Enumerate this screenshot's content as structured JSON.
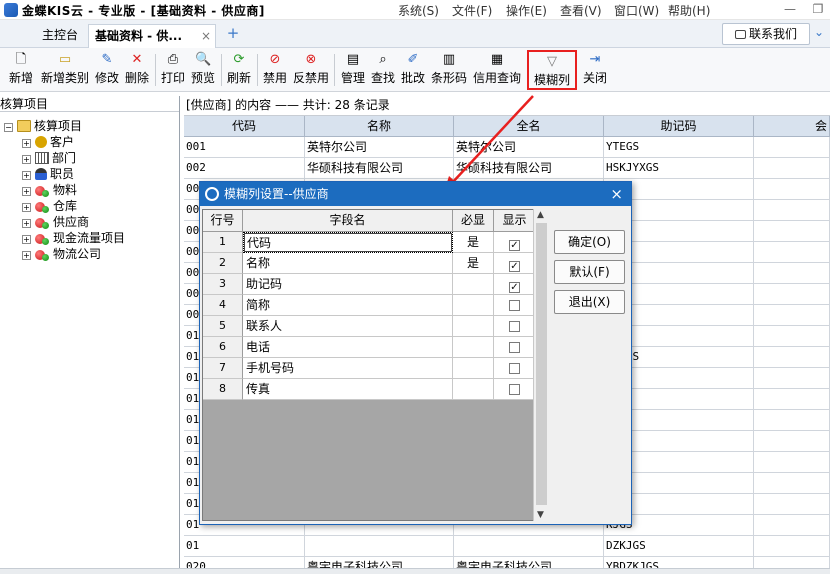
{
  "title_bar": {
    "app_title": "金蝶KIS云 - 专业版 - [基础资料 - 供应商]",
    "menus": [
      "系统(S)",
      "文件(F)",
      "操作(E)",
      "查看(V)",
      "窗口(W)",
      "帮助(H)"
    ]
  },
  "tabs": {
    "main_label": "主控台",
    "supplier_label": "基础资料 - 供...",
    "close_glyph": "×",
    "add_glyph": "+"
  },
  "contact_label": "联系我们",
  "toolbar": {
    "new": "新增",
    "new_category": "新增类别",
    "modify": "修改",
    "delete": "删除",
    "print": "打印",
    "preview": "预览",
    "refresh": "刷新",
    "disable": "禁用",
    "enable": "反禁用",
    "manage": "管理",
    "find": "查找",
    "batch_modify": "批改",
    "barcode": "条形码",
    "credit_query": "信用查询",
    "fuzzy_column": "模糊列",
    "close": "关闭"
  },
  "tree": {
    "header": "核算项目",
    "root": "核算项目",
    "items": [
      "客户",
      "部门",
      "职员",
      "物料",
      "仓库",
      "供应商",
      "现金流量项目",
      "物流公司"
    ]
  },
  "content": {
    "header": "[供应商] 的内容 —— 共计: 28 条记录",
    "columns": [
      "代码",
      "名称",
      "全名",
      "助记码",
      "会"
    ],
    "rows": [
      {
        "code": "001",
        "name": "英特尔公司",
        "fullname": "英特尔公司",
        "mnemonic": "YTEGS"
      },
      {
        "code": "002",
        "name": "华硕科技有限公司",
        "fullname": "华硕科技有限公司",
        "mnemonic": "HSKJYXGS"
      },
      {
        "code": "00",
        "name": "",
        "fullname": "",
        "mnemonic": ""
      },
      {
        "code": "00",
        "name": "",
        "fullname": "",
        "mnemonic": ""
      },
      {
        "code": "00",
        "name": "",
        "fullname": "",
        "mnemonic": ""
      },
      {
        "code": "00",
        "name": "",
        "fullname": "",
        "mnemonic": ""
      },
      {
        "code": "00",
        "name": "",
        "fullname": "",
        "mnemonic": "GS"
      },
      {
        "code": "00",
        "name": "",
        "fullname": "",
        "mnemonic": "YXGS"
      },
      {
        "code": "00",
        "name": "",
        "fullname": "",
        "mnemonic": "YXGS"
      },
      {
        "code": "01",
        "name": "",
        "fullname": "",
        "mnemonic": "C"
      },
      {
        "code": "01",
        "name": "",
        "fullname": "",
        "mnemonic": "GYXGS"
      },
      {
        "code": "01",
        "name": "",
        "fullname": "",
        "mnemonic": "YXGS"
      },
      {
        "code": "01",
        "name": "",
        "fullname": "",
        "mnemonic": "YXGS"
      },
      {
        "code": "01",
        "name": "",
        "fullname": "",
        "mnemonic": "YXGS"
      },
      {
        "code": "01",
        "name": "",
        "fullname": "",
        "mnemonic": "SKJ"
      },
      {
        "code": "01",
        "name": "",
        "fullname": "",
        "mnemonic": "KJ"
      },
      {
        "code": "01",
        "name": "",
        "fullname": "",
        "mnemonic": "KJ"
      },
      {
        "code": "01",
        "name": "",
        "fullname": "",
        "mnemonic": "KJ"
      },
      {
        "code": "01",
        "name": "",
        "fullname": "",
        "mnemonic": "KJGS"
      },
      {
        "code": "01",
        "name": "",
        "fullname": "",
        "mnemonic": "DZKJGS"
      },
      {
        "code": "020",
        "name": "粤宇电子科技公司",
        "fullname": "粤宇电子科技公司",
        "mnemonic": "YBDZKJGS"
      }
    ]
  },
  "dialog": {
    "title": "模糊列设置--供应商",
    "close_glyph": "×",
    "columns": [
      "行号",
      "字段名",
      "必显",
      "显示"
    ],
    "rows": [
      {
        "num": "1",
        "field": "代码",
        "required": "是",
        "show": true
      },
      {
        "num": "2",
        "field": "名称",
        "required": "是",
        "show": true
      },
      {
        "num": "3",
        "field": "助记码",
        "required": "",
        "show": true
      },
      {
        "num": "4",
        "field": "简称",
        "required": "",
        "show": false
      },
      {
        "num": "5",
        "field": "联系人",
        "required": "",
        "show": false
      },
      {
        "num": "6",
        "field": "电话",
        "required": "",
        "show": false
      },
      {
        "num": "7",
        "field": "手机号码",
        "required": "",
        "show": false
      },
      {
        "num": "8",
        "field": "传真",
        "required": "",
        "show": false
      }
    ],
    "buttons": {
      "ok": "确定(O)",
      "default": "默认(F)",
      "exit": "退出(X)"
    }
  },
  "colors": {
    "dialog_title": "#1c6cbf",
    "highlight_red": "#e8201f",
    "grid_header": "#d8e2ee"
  }
}
